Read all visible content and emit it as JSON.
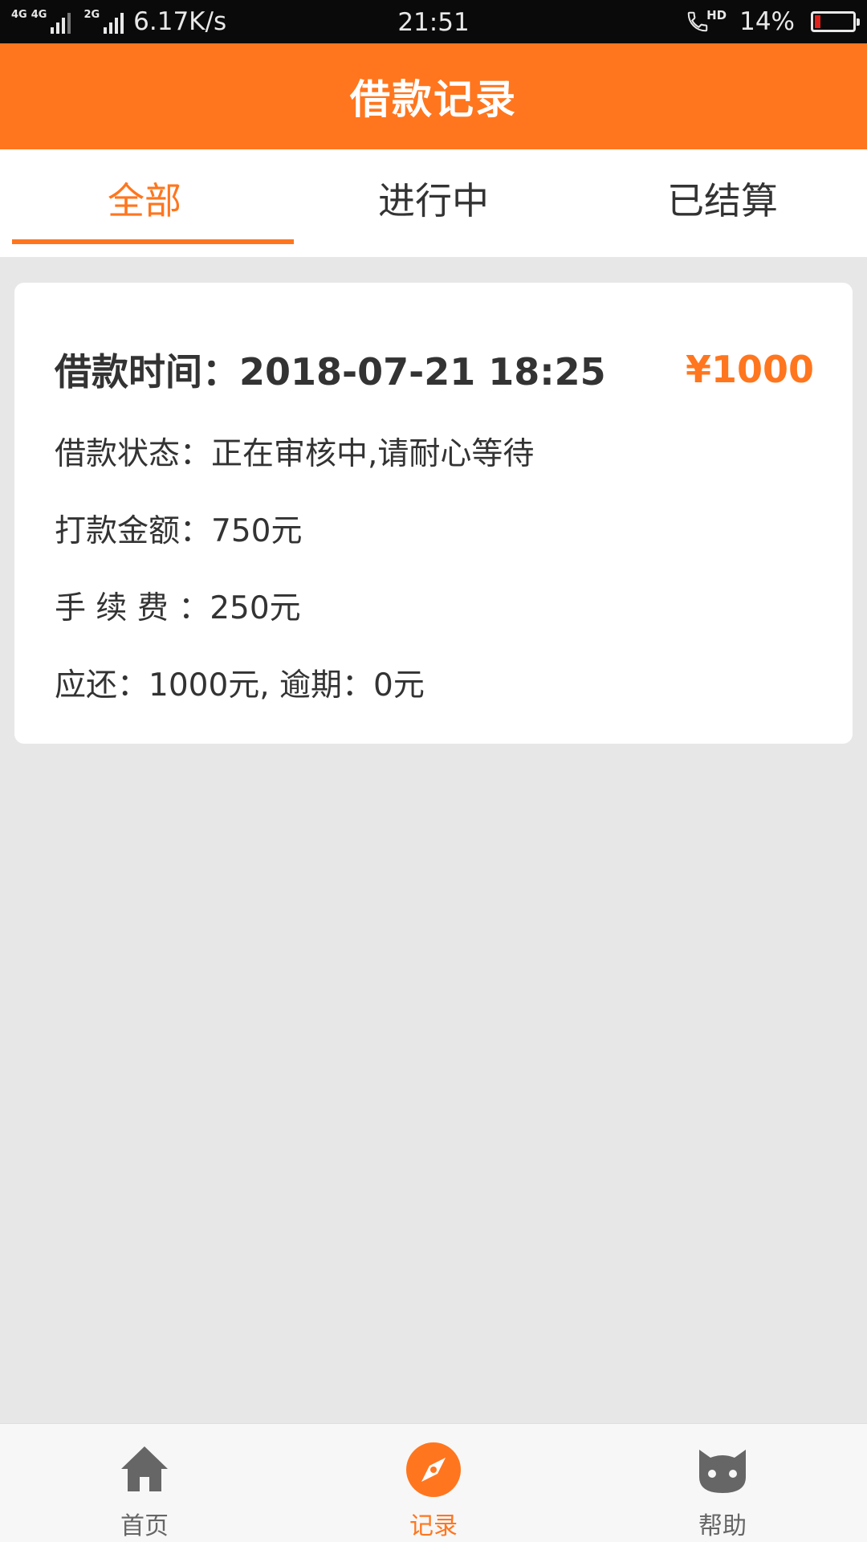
{
  "status_bar": {
    "sim1_label": "4G",
    "sim1_label2": "4G",
    "sim2_label": "2G",
    "net_speed": "6.17K/s",
    "time": "21:51",
    "hd_label": "HD",
    "battery": "14%",
    "battery_level": 0.14,
    "battery_color": "#e0221c"
  },
  "header": {
    "title": "借款记录",
    "bg_color": "#ff761e"
  },
  "tabs": [
    {
      "label": "全部",
      "active": true
    },
    {
      "label": "进行中",
      "active": false
    },
    {
      "label": "已结算",
      "active": false
    }
  ],
  "record": {
    "time_label": "借款时间：2018-07-21 18:25",
    "amount": "¥1000",
    "status_line": "借款状态：正在审核中,请耐心等待",
    "payout_line": "打款金额：750元",
    "fee_line": "手 续 费 ：250元",
    "due_line": "应还：1000元, 逾期：0元"
  },
  "bottom_nav": [
    {
      "label": "首页",
      "icon": "home-icon",
      "active": false
    },
    {
      "label": "记录",
      "icon": "compass-icon",
      "active": true
    },
    {
      "label": "帮助",
      "icon": "cat-icon",
      "active": false
    }
  ],
  "colors": {
    "accent": "#ff761e",
    "text": "#333333",
    "background": "#e7e7e7"
  }
}
